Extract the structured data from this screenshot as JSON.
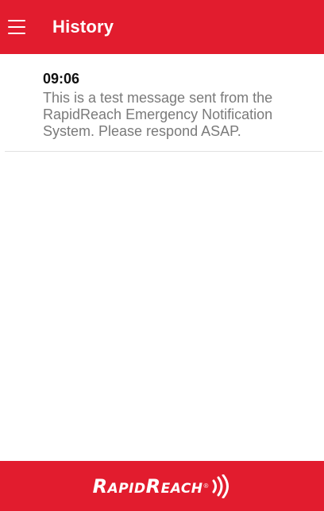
{
  "header": {
    "title": "History",
    "menu_icon": "hamburger-menu-icon"
  },
  "messages": [
    {
      "time": "09:06",
      "text": "This is a test message sent from the RapidReach Emergency Notification System. Please respond ASAP."
    }
  ],
  "footer": {
    "logo_text": "RapidReach",
    "logo_reg": "®",
    "logo_icon": "signal-waves-icon"
  },
  "colors": {
    "brand_red": "#e21c2e",
    "message_text": "#7a7a7a",
    "divider": "#e2e2e2"
  }
}
